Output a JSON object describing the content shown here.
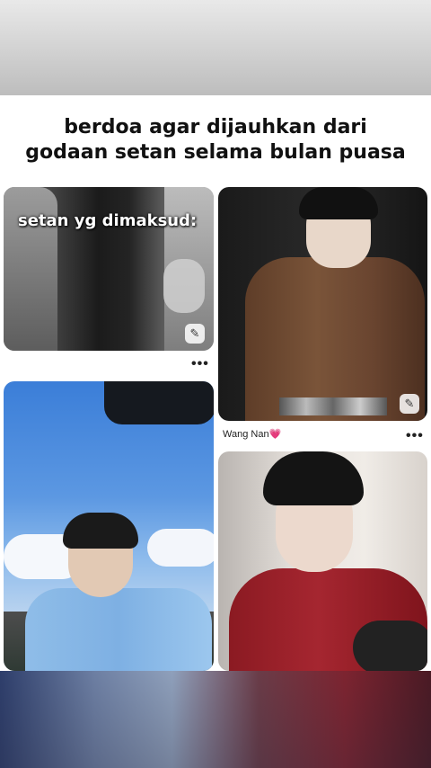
{
  "caption": {
    "line1": "berdoa agar dijauhkan dari",
    "line2": "godaan setan selama bulan puasa"
  },
  "pins": [
    {
      "overlay_text": "setan yg dimaksud:",
      "more": "•••"
    },
    {
      "label": "Wang Nan",
      "label_emoji": "💗",
      "more": "•••"
    },
    {},
    {}
  ],
  "icons": {
    "pin_badge": "push-pin-icon",
    "more": "more-options-icon"
  }
}
